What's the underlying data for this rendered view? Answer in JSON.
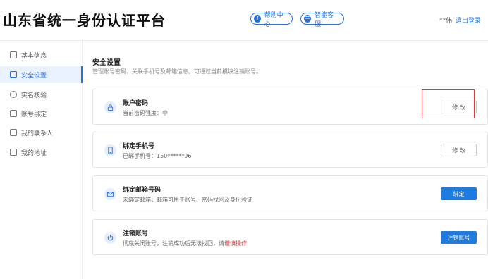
{
  "header": {
    "title": "山东省统一身份认证平台",
    "help_label": "帮助中心",
    "service_label": "智能客服",
    "user_name": "**伟",
    "logout_label": "退出登录"
  },
  "sidebar": {
    "items": [
      {
        "label": "基本信息",
        "active": false
      },
      {
        "label": "安全设置",
        "active": true
      },
      {
        "label": "实名核验",
        "active": false
      },
      {
        "label": "账号绑定",
        "active": false
      },
      {
        "label": "我的联系人",
        "active": false
      },
      {
        "label": "我的地址",
        "active": false
      }
    ]
  },
  "main": {
    "section_title": "安全设置",
    "section_desc": "管理账号密码、关联手机号及邮箱信息。可通过当前模块注销账号。",
    "cards": [
      {
        "title": "账户密码",
        "subtitle": "当前密码强度：中",
        "button": "修 改",
        "icon": "lock-icon"
      },
      {
        "title": "绑定手机号",
        "subtitle": "已绑手机号：150******96",
        "button": "修 改",
        "icon": "phone-icon"
      },
      {
        "title": "绑定邮箱号码",
        "subtitle": "未绑定邮箱，邮箱可用于账号、密码找回及身份验证",
        "button": "绑定",
        "icon": "mail-icon"
      },
      {
        "title": "注销账号",
        "subtitle": "彻底关闭账号，注销成功后无法找回，请",
        "subtitle_warn": "谨慎操作",
        "button": "注销账号",
        "icon": "power-icon"
      }
    ]
  },
  "colors": {
    "accent": "#1e7be0",
    "warn": "#e4393c",
    "highlight": "#e4393c"
  }
}
